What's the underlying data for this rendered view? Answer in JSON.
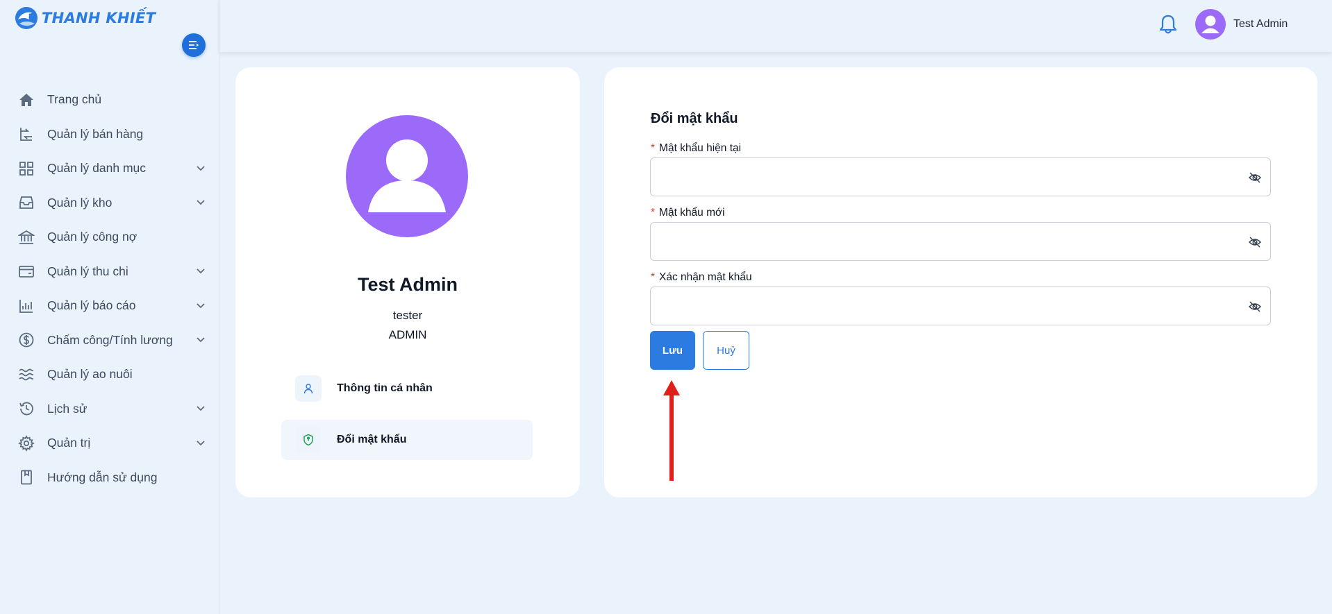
{
  "brand": {
    "name": "THANH KHIẾT"
  },
  "sidebar": {
    "items": [
      {
        "label": "Trang chủ",
        "icon": "home-icon",
        "expandable": false
      },
      {
        "label": "Quản lý bán hàng",
        "icon": "sales-icon",
        "expandable": false
      },
      {
        "label": "Quản lý danh mục",
        "icon": "grid-icon",
        "expandable": true
      },
      {
        "label": "Quản lý kho",
        "icon": "inbox-icon",
        "expandable": true
      },
      {
        "label": "Quản lý công nợ",
        "icon": "bank-icon",
        "expandable": false
      },
      {
        "label": "Quản lý thu chi",
        "icon": "wallet-icon",
        "expandable": true
      },
      {
        "label": "Quản lý báo cáo",
        "icon": "bar-chart-icon",
        "expandable": true
      },
      {
        "label": "Chấm công/Tính lương",
        "icon": "dollar-icon",
        "expandable": true
      },
      {
        "label": "Quản lý ao nuôi",
        "icon": "waves-icon",
        "expandable": false
      },
      {
        "label": "Lịch sử",
        "icon": "history-icon",
        "expandable": true
      },
      {
        "label": "Quản trị",
        "icon": "gear-icon",
        "expandable": true
      },
      {
        "label": "Hướng dẫn sử dụng",
        "icon": "book-icon",
        "expandable": false
      }
    ]
  },
  "header": {
    "user_name": "Test Admin"
  },
  "profile": {
    "name": "Test Admin",
    "username": "tester",
    "role": "ADMIN",
    "menu": [
      {
        "label": "Thông tin cá nhân",
        "icon": "user-icon",
        "active": false
      },
      {
        "label": "Đổi mật khẩu",
        "icon": "shield-icon",
        "active": true
      }
    ]
  },
  "form": {
    "title": "Đổi mật khẩu",
    "fields": [
      {
        "label": "Mật khẩu hiện tại",
        "value": ""
      },
      {
        "label": "Mật khẩu mới",
        "value": ""
      },
      {
        "label": "Xác nhận mật khẩu",
        "value": ""
      }
    ],
    "save_label": "Lưu",
    "cancel_label": "Huỷ"
  },
  "colors": {
    "primary": "#2b7be0",
    "avatar": "#9b6af8",
    "required": "#e53935",
    "annotation_arrow": "#e0201b"
  }
}
